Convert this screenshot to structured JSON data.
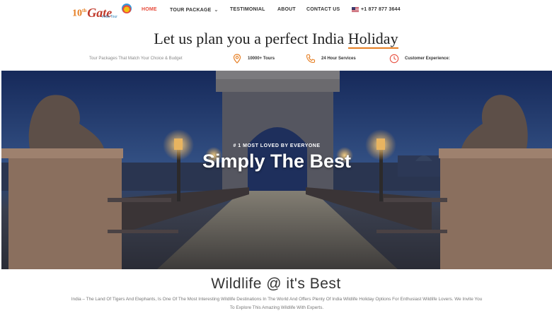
{
  "logo": {
    "number": "10",
    "suffix": "th",
    "name": "Gate",
    "tagline": "India Tour"
  },
  "nav": {
    "home": "HOME",
    "tour_package": "TOUR PACKAGE",
    "testimonial": "TESTIMONIAL",
    "about": "ABOUT",
    "contact": "CONTACT US",
    "phone": "+1 877 877 3644"
  },
  "intro": {
    "headline_prefix": "Let us plan you a perfect India",
    "headline_highlight": "Holiday",
    "subline": "Tour Packages That Match Your Choice & Budget",
    "features": [
      {
        "icon": "location-pin-icon",
        "label": "10000+ Tours"
      },
      {
        "icon": "phone-icon",
        "label": "24 Hour Services"
      },
      {
        "icon": "clock-icon",
        "label": "Customer Experience:"
      }
    ]
  },
  "hero": {
    "tag": "# 1 MOST LOVED BY EVERYONE",
    "title": "Simply The Best"
  },
  "wildlife": {
    "title": "Wildlife @ it's Best",
    "description": "India – The Land Of Tigers And Elephants, Is One Of The Most Interesting Wildlife Destinations In The World And Offers Plenty Of India Wildlife Holiday Options For Enthusiast Wildlife Lovers. We Invite You To Explore This Amazing Wildlife With Experts."
  },
  "colors": {
    "accent": "#e74c3c",
    "orange": "#e67e22"
  }
}
